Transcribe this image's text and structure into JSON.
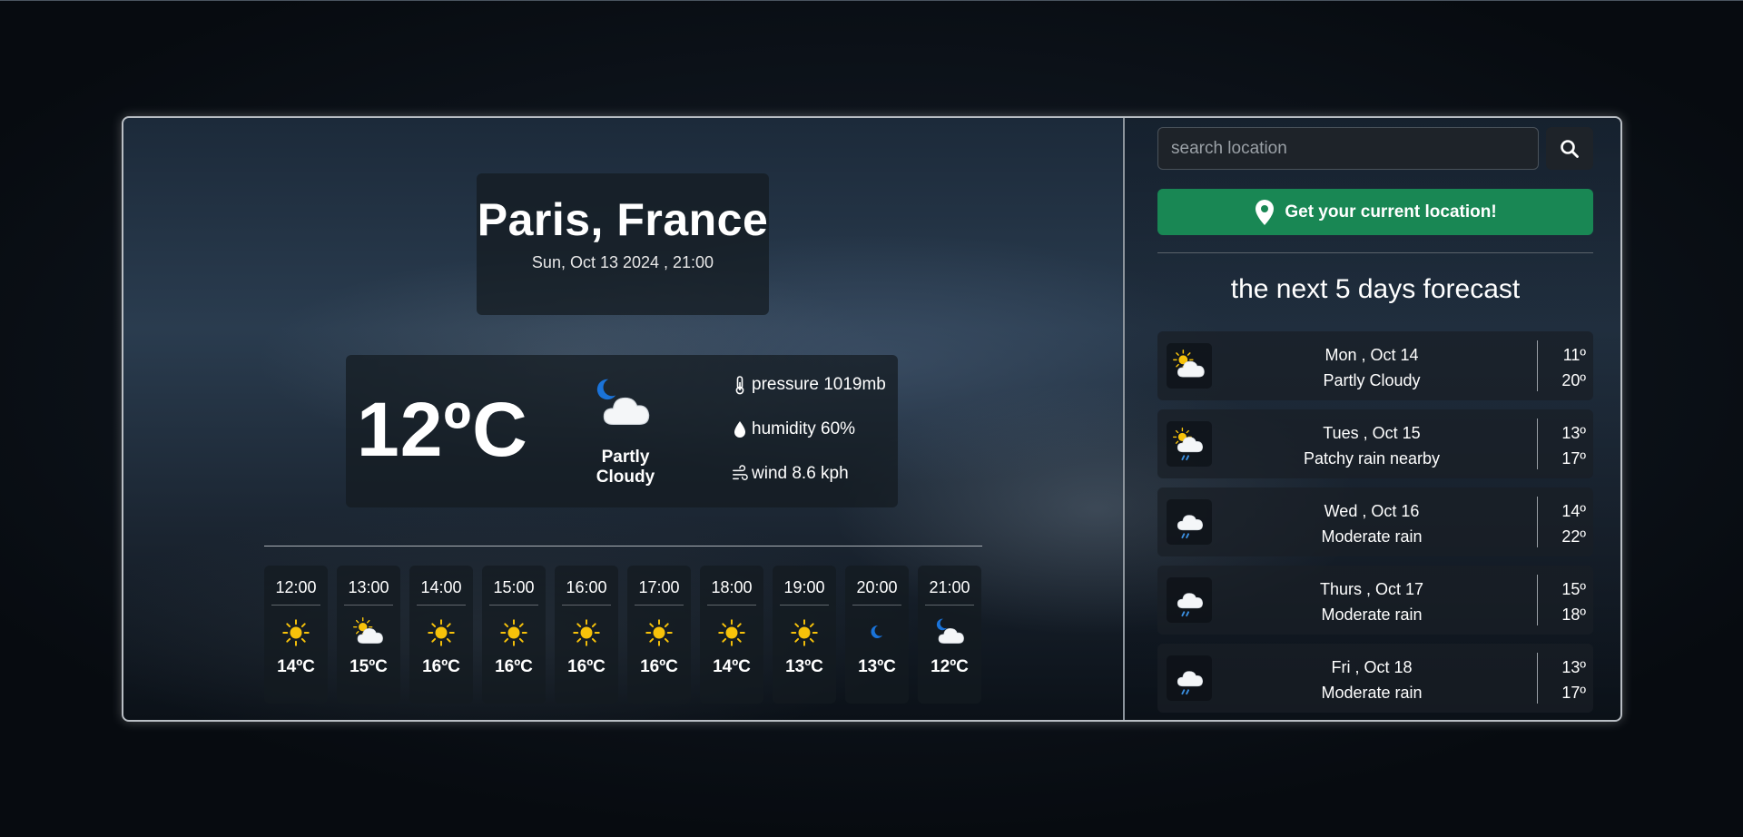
{
  "location": {
    "city": "Paris, France",
    "datetime": "Sun, Oct 13 2024 , 21:00"
  },
  "current": {
    "temp": "12ºC",
    "condition": "Partly Cloudy",
    "icon": "moon-cloud-icon",
    "pressure": "pressure 1019mb",
    "humidity": "humidity 60%",
    "wind": "wind 8.6 kph"
  },
  "hourly": [
    {
      "time": "12:00",
      "temp": "14ºC",
      "icon": "sun-icon"
    },
    {
      "time": "13:00",
      "temp": "15ºC",
      "icon": "sun-cloud-icon"
    },
    {
      "time": "14:00",
      "temp": "16ºC",
      "icon": "sun-icon"
    },
    {
      "time": "15:00",
      "temp": "16ºC",
      "icon": "sun-icon"
    },
    {
      "time": "16:00",
      "temp": "16ºC",
      "icon": "sun-icon"
    },
    {
      "time": "17:00",
      "temp": "16ºC",
      "icon": "sun-icon"
    },
    {
      "time": "18:00",
      "temp": "14ºC",
      "icon": "sun-icon"
    },
    {
      "time": "19:00",
      "temp": "13ºC",
      "icon": "sun-icon"
    },
    {
      "time": "20:00",
      "temp": "13ºC",
      "icon": "moon-icon"
    },
    {
      "time": "21:00",
      "temp": "12ºC",
      "icon": "moon-cloud-icon"
    }
  ],
  "search": {
    "placeholder": "search location"
  },
  "location_button": {
    "label": "Get your current location!"
  },
  "forecast": {
    "title": "the next 5 days forecast",
    "days": [
      {
        "date": "Mon , Oct 14",
        "condition": "Partly Cloudy",
        "low": "11º",
        "high": "20º",
        "icon": "sun-cloud-icon"
      },
      {
        "date": "Tues , Oct 15",
        "condition": "Patchy rain nearby",
        "low": "13º",
        "high": "17º",
        "icon": "sun-rain-icon"
      },
      {
        "date": "Wed , Oct 16",
        "condition": "Moderate rain",
        "low": "14º",
        "high": "22º",
        "icon": "rain-cloud-icon"
      },
      {
        "date": "Thurs , Oct 17",
        "condition": "Moderate rain",
        "low": "15º",
        "high": "18º",
        "icon": "rain-cloud-icon"
      },
      {
        "date": "Fri , Oct 18",
        "condition": "Moderate rain",
        "low": "13º",
        "high": "17º",
        "icon": "rain-cloud-icon"
      }
    ]
  },
  "colors": {
    "accent_green": "#198754",
    "sun": "#f7c20a",
    "moon": "#1a73d9"
  }
}
